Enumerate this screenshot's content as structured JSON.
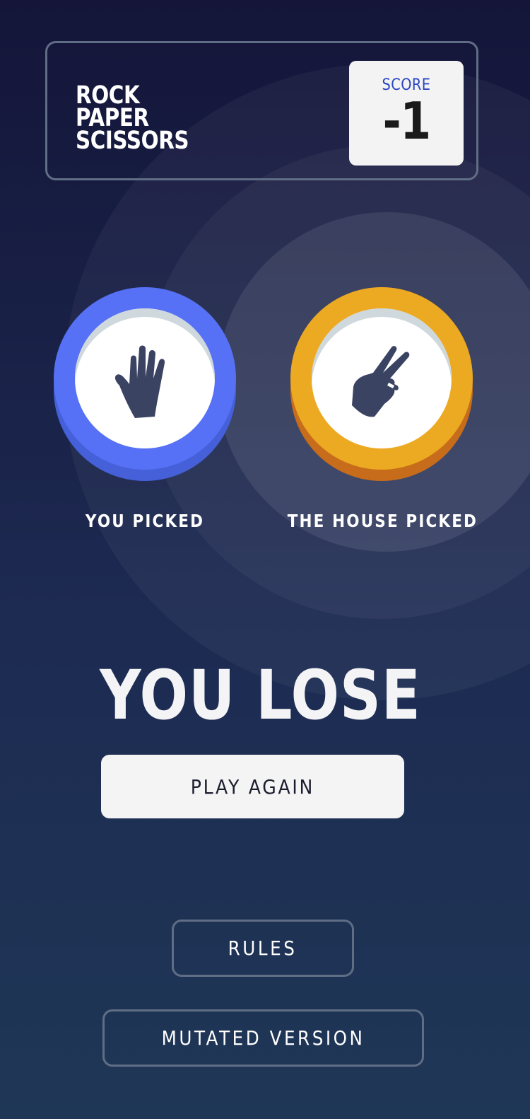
{
  "header": {
    "logo_lines": [
      "ROCK",
      "PAPER",
      "SCISSORS"
    ],
    "score_label": "SCORE",
    "score_value": "-1"
  },
  "game": {
    "player": {
      "label": "YOU PICKED",
      "choice": "paper",
      "icon": "paper-hand-icon",
      "color": "#5671f5"
    },
    "house": {
      "label": "THE HOUSE PICKED",
      "choice": "scissors",
      "icon": "scissors-hand-icon",
      "color": "#eca922"
    },
    "result": "YOU LOSE",
    "play_again_label": "PLAY AGAIN"
  },
  "footer": {
    "rules_label": "RULES",
    "mutated_label": "MUTATED VERSION"
  }
}
